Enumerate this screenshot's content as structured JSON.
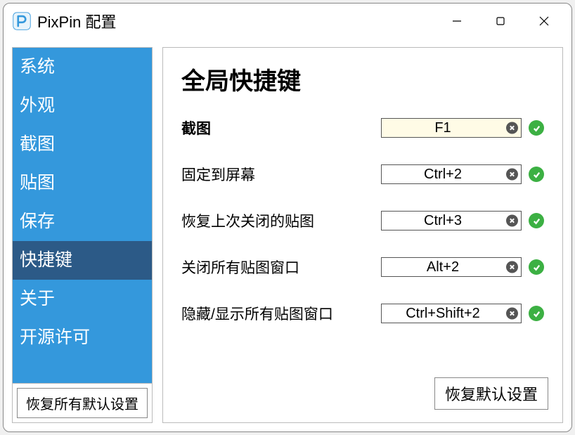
{
  "window": {
    "title": "PixPin 配置"
  },
  "sidebar": {
    "items": [
      {
        "label": "系统",
        "active": false
      },
      {
        "label": "外观",
        "active": false
      },
      {
        "label": "截图",
        "active": false
      },
      {
        "label": "贴图",
        "active": false
      },
      {
        "label": "保存",
        "active": false
      },
      {
        "label": "快捷键",
        "active": true
      },
      {
        "label": "关于",
        "active": false
      },
      {
        "label": "开源许可",
        "active": false
      }
    ],
    "restore_all_label": "恢复所有默认设置"
  },
  "main": {
    "title": "全局快捷键",
    "shortcuts": [
      {
        "label": "截图",
        "value": "F1",
        "bold": true,
        "highlight": true,
        "status": "ok"
      },
      {
        "label": "固定到屏幕",
        "value": "Ctrl+2",
        "bold": false,
        "highlight": false,
        "status": "ok"
      },
      {
        "label": "恢复上次关闭的贴图",
        "value": "Ctrl+3",
        "bold": false,
        "highlight": false,
        "status": "ok"
      },
      {
        "label": "关闭所有贴图窗口",
        "value": "Alt+2",
        "bold": false,
        "highlight": false,
        "status": "ok"
      },
      {
        "label": "隐藏/显示所有贴图窗口",
        "value": "Ctrl+Shift+2",
        "bold": false,
        "highlight": false,
        "status": "ok"
      }
    ],
    "restore_default_label": "恢复默认设置"
  },
  "colors": {
    "sidebar_bg": "#3498dc",
    "sidebar_active": "#2c5a87",
    "status_ok": "#3cb043"
  }
}
